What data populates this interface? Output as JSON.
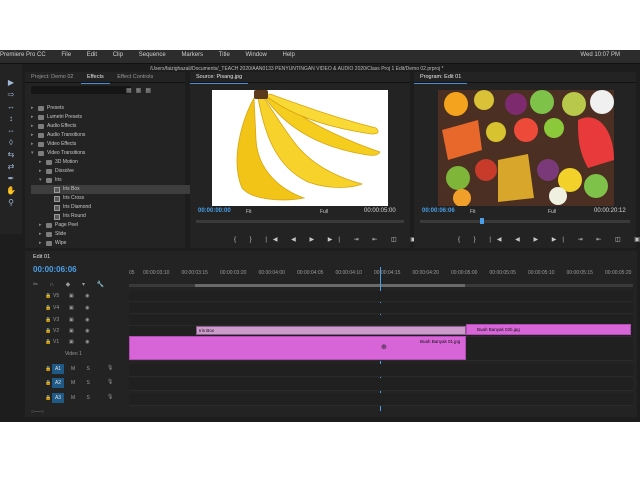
{
  "window": {
    "title": "/Users/faizighazali/Documents/_TEACH 2020/AAN0133 PENYUNTINGAN VIDEO & AUDIO 2020/Class Proj 1 Edit/Demo 02.prproj *"
  },
  "menu": {
    "items": [
      "Premiere Pro CC",
      "File",
      "Edit",
      "Clip",
      "Sequence",
      "Markers",
      "Title",
      "Window",
      "Help"
    ],
    "right": "Wed 10:07 PM"
  },
  "effects_panel": {
    "tabs": [
      {
        "label": "Project: Demo 02"
      },
      {
        "label": "Effects"
      },
      {
        "label": "Effect Controls"
      }
    ],
    "items": [
      {
        "label": "Presets",
        "level": 0,
        "kind": "folder"
      },
      {
        "label": "Lumetri Presets",
        "level": 0,
        "kind": "folder"
      },
      {
        "label": "Audio Effects",
        "level": 0,
        "kind": "folder"
      },
      {
        "label": "Audio Transitions",
        "level": 0,
        "kind": "folder"
      },
      {
        "label": "Video Effects",
        "level": 0,
        "kind": "folder"
      },
      {
        "label": "Video Transitions",
        "level": 0,
        "kind": "folder",
        "open": true
      },
      {
        "label": "3D Motion",
        "level": 1,
        "kind": "folder"
      },
      {
        "label": "Dissolve",
        "level": 1,
        "kind": "folder"
      },
      {
        "label": "Iris",
        "level": 1,
        "kind": "folder",
        "open": true
      },
      {
        "label": "Iris Box",
        "level": 2,
        "kind": "effect",
        "selected": true
      },
      {
        "label": "Iris Cross",
        "level": 2,
        "kind": "effect"
      },
      {
        "label": "Iris Diamond",
        "level": 2,
        "kind": "effect"
      },
      {
        "label": "Iris Round",
        "level": 2,
        "kind": "effect"
      },
      {
        "label": "Page Peel",
        "level": 1,
        "kind": "folder"
      },
      {
        "label": "Slide",
        "level": 1,
        "kind": "folder"
      },
      {
        "label": "Wipe",
        "level": 1,
        "kind": "folder"
      }
    ]
  },
  "source_monitor": {
    "tab": "Source: Pisang.jpg",
    "timecode": "00:00:00:00",
    "fit": "Fit",
    "quality": "Full",
    "duration": "00:00:05:00"
  },
  "program_monitor": {
    "tab": "Program: Edit 01",
    "timecode": "00:00:06:06",
    "fit": "Fit",
    "quality": "Full",
    "duration": "00:00:20:12"
  },
  "timeline": {
    "tab": "Edit 01",
    "timecode": "00:00:06:06",
    "ruler": [
      "05",
      "00:00:03:10",
      "00:00:03:15",
      "00:00:03:20",
      "00:00:04:00",
      "00:00:04:05",
      "00:00:04:10",
      "00:00:04:15",
      "00:00:04:20",
      "00:00:05:00",
      "00:00:05:05",
      "00:00:05:10",
      "00:00:05:15",
      "00:00:05:20"
    ],
    "video_tracks": [
      "V5",
      "V4",
      "V3",
      "V2",
      "V1"
    ],
    "video_track_name": "Video 1",
    "audio_tracks": [
      "A1",
      "A2",
      "A3"
    ],
    "track_toggles": "M S",
    "clips": {
      "transition": "Iris Box",
      "v2_clip": "Buah Banyak 02b.jpg",
      "v1_clip": "Buah Banyak 01.jpg"
    }
  },
  "colors": {
    "accent": "#4a9fe8",
    "clip": "#d765d8",
    "transition": "#cc9acb",
    "panel": "#232323"
  }
}
